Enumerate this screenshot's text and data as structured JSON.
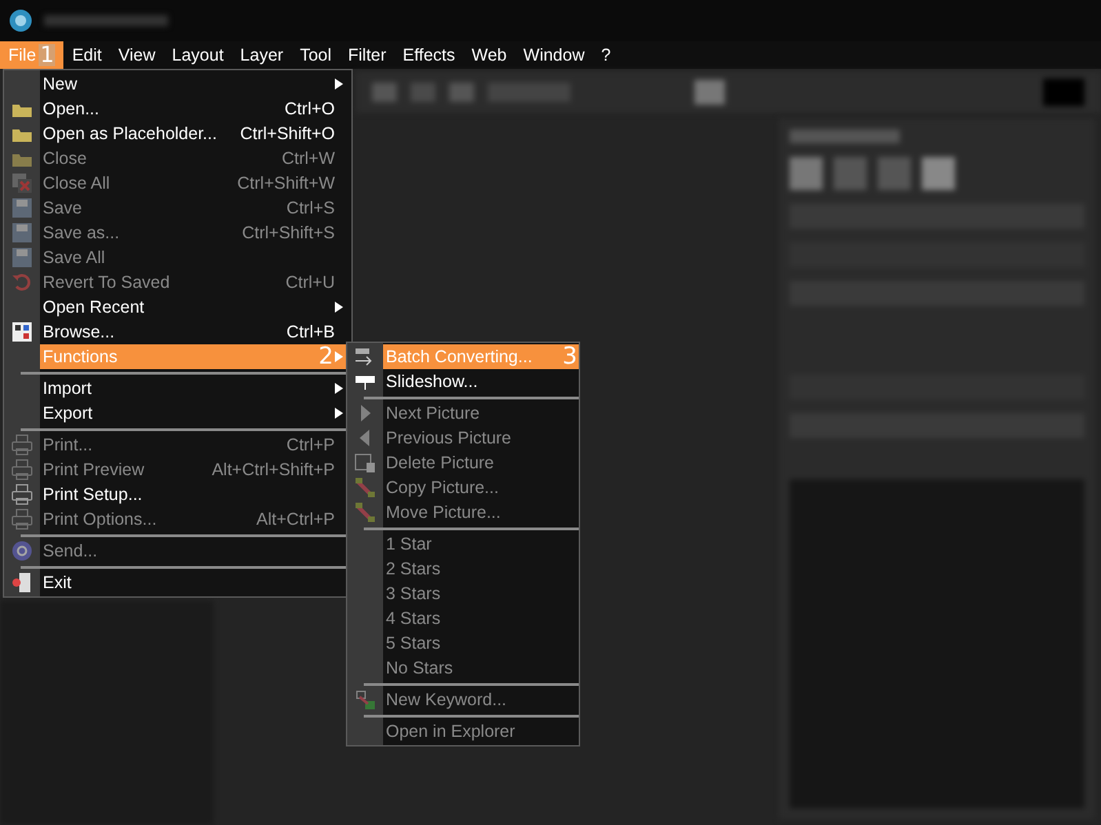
{
  "menu_bar": [
    {
      "label": "File",
      "selected": true,
      "marker": "1"
    },
    {
      "label": "Edit",
      "selected": false
    },
    {
      "label": "View",
      "selected": false
    },
    {
      "label": "Layout",
      "selected": false
    },
    {
      "label": "Layer",
      "selected": false
    },
    {
      "label": "Tool",
      "selected": false
    },
    {
      "label": "Filter",
      "selected": false
    },
    {
      "label": "Effects",
      "selected": false
    },
    {
      "label": "Web",
      "selected": false
    },
    {
      "label": "Window",
      "selected": false
    },
    {
      "label": "?",
      "selected": false
    }
  ],
  "file_menu": [
    {
      "kind": "item",
      "label": "New",
      "submenu": true,
      "disabled": false,
      "selected": false
    },
    {
      "kind": "item",
      "label": "Open...",
      "shortcut": "Ctrl+O",
      "disabled": false,
      "selected": false
    },
    {
      "kind": "item",
      "label": "Open as Placeholder...",
      "shortcut": "Ctrl+Shift+O",
      "disabled": false,
      "selected": false
    },
    {
      "kind": "item",
      "label": "Close",
      "shortcut": "Ctrl+W",
      "disabled": true,
      "selected": false
    },
    {
      "kind": "item",
      "label": "Close All",
      "shortcut": "Ctrl+Shift+W",
      "disabled": true,
      "selected": false
    },
    {
      "kind": "item",
      "label": "Save",
      "shortcut": "Ctrl+S",
      "disabled": true,
      "selected": false
    },
    {
      "kind": "item",
      "label": "Save as...",
      "shortcut": "Ctrl+Shift+S",
      "disabled": true,
      "selected": false
    },
    {
      "kind": "item",
      "label": "Save All",
      "disabled": true,
      "selected": false
    },
    {
      "kind": "item",
      "label": "Revert To Saved",
      "shortcut": "Ctrl+U",
      "disabled": true,
      "selected": false
    },
    {
      "kind": "item",
      "label": "Open Recent",
      "submenu": true,
      "disabled": false,
      "selected": false
    },
    {
      "kind": "item",
      "label": "Browse...",
      "shortcut": "Ctrl+B",
      "disabled": false,
      "selected": false
    },
    {
      "kind": "item",
      "label": "Functions",
      "submenu": true,
      "disabled": false,
      "selected": true,
      "marker": "2"
    },
    {
      "kind": "separator"
    },
    {
      "kind": "item",
      "label": "Import",
      "submenu": true,
      "disabled": false,
      "selected": false
    },
    {
      "kind": "item",
      "label": "Export",
      "submenu": true,
      "disabled": false,
      "selected": false
    },
    {
      "kind": "separator"
    },
    {
      "kind": "item",
      "label": "Print...",
      "shortcut": "Ctrl+P",
      "disabled": true,
      "selected": false
    },
    {
      "kind": "item",
      "label": "Print Preview",
      "shortcut": "Alt+Ctrl+Shift+P",
      "disabled": true,
      "selected": false
    },
    {
      "kind": "item",
      "label": "Print Setup...",
      "disabled": false,
      "selected": false
    },
    {
      "kind": "item",
      "label": "Print Options...",
      "shortcut": "Alt+Ctrl+P",
      "disabled": true,
      "selected": false
    },
    {
      "kind": "separator"
    },
    {
      "kind": "item",
      "label": "Send...",
      "disabled": true,
      "selected": false
    },
    {
      "kind": "separator"
    },
    {
      "kind": "item",
      "label": "Exit",
      "disabled": false,
      "selected": false
    }
  ],
  "functions_menu": [
    {
      "kind": "item",
      "label": "Batch Converting...",
      "disabled": false,
      "selected": true,
      "marker": "3"
    },
    {
      "kind": "item",
      "label": "Slideshow...",
      "disabled": false,
      "selected": false
    },
    {
      "kind": "separator"
    },
    {
      "kind": "item",
      "label": "Next Picture",
      "disabled": true,
      "selected": false
    },
    {
      "kind": "item",
      "label": "Previous Picture",
      "disabled": true,
      "selected": false
    },
    {
      "kind": "item",
      "label": "Delete Picture",
      "disabled": true,
      "selected": false
    },
    {
      "kind": "item",
      "label": "Copy Picture...",
      "disabled": true,
      "selected": false
    },
    {
      "kind": "item",
      "label": "Move Picture...",
      "disabled": true,
      "selected": false
    },
    {
      "kind": "separator"
    },
    {
      "kind": "item",
      "label": "1 Star",
      "disabled": true,
      "selected": false
    },
    {
      "kind": "item",
      "label": "2 Stars",
      "disabled": true,
      "selected": false
    },
    {
      "kind": "item",
      "label": "3 Stars",
      "disabled": true,
      "selected": false
    },
    {
      "kind": "item",
      "label": "4 Stars",
      "disabled": true,
      "selected": false
    },
    {
      "kind": "item",
      "label": "5 Stars",
      "disabled": true,
      "selected": false
    },
    {
      "kind": "item",
      "label": "No Stars",
      "disabled": true,
      "selected": false
    },
    {
      "kind": "separator"
    },
    {
      "kind": "item",
      "label": "New Keyword...",
      "disabled": true,
      "selected": false
    },
    {
      "kind": "separator"
    },
    {
      "kind": "item",
      "label": "Open in Explorer",
      "disabled": true,
      "selected": false
    }
  ]
}
